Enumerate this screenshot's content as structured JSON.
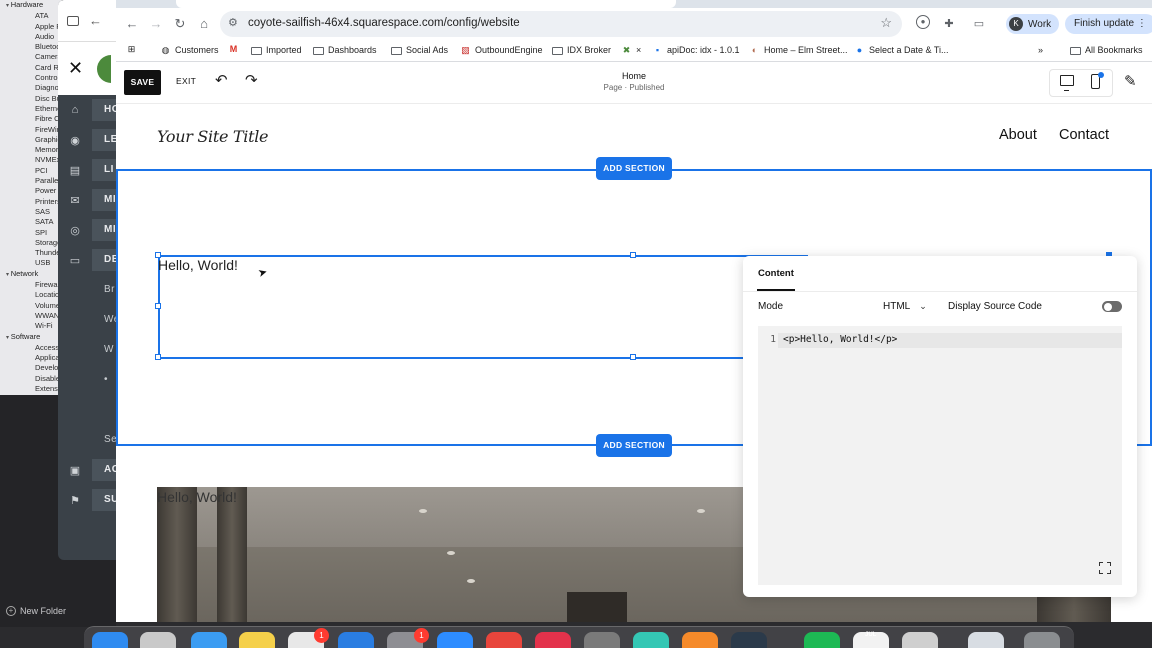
{
  "sysinfo": {
    "tree": [
      {
        "label": "Hardware",
        "level": "cat"
      },
      {
        "label": "ATA",
        "level": "sub"
      },
      {
        "label": "Apple Pay",
        "level": "sub"
      },
      {
        "label": "Audio",
        "level": "sub"
      },
      {
        "label": "Bluetooth",
        "level": "sub"
      },
      {
        "label": "Camera",
        "level": "sub"
      },
      {
        "label": "Card Reader",
        "level": "sub"
      },
      {
        "label": "Controller",
        "level": "sub"
      },
      {
        "label": "Diagnostics",
        "level": "sub"
      },
      {
        "label": "Disc Burning",
        "level": "sub"
      },
      {
        "label": "Ethernet",
        "level": "sub"
      },
      {
        "label": "Fibre Channel",
        "level": "sub"
      },
      {
        "label": "FireWire",
        "level": "sub"
      },
      {
        "label": "Graphics",
        "level": "sub"
      },
      {
        "label": "Memory",
        "level": "sub"
      },
      {
        "label": "NVMExpress",
        "level": "sub"
      },
      {
        "label": "PCI",
        "level": "sub"
      },
      {
        "label": "Parallel SCSI",
        "level": "sub"
      },
      {
        "label": "Power",
        "level": "sub"
      },
      {
        "label": "Printers",
        "level": "sub"
      },
      {
        "label": "SAS",
        "level": "sub"
      },
      {
        "label": "SATA",
        "level": "sub"
      },
      {
        "label": "SPI",
        "level": "sub"
      },
      {
        "label": "Storage",
        "level": "sub"
      },
      {
        "label": "Thunderbolt",
        "level": "sub"
      },
      {
        "label": "USB",
        "level": "sub"
      },
      {
        "label": "Network",
        "level": "cat"
      },
      {
        "label": "Firewall",
        "level": "sub"
      },
      {
        "label": "Locations",
        "level": "sub"
      },
      {
        "label": "Volumes",
        "level": "sub"
      },
      {
        "label": "WWAN",
        "level": "sub"
      },
      {
        "label": "Wi-Fi",
        "level": "sub"
      },
      {
        "label": "Software",
        "level": "cat"
      },
      {
        "label": "Accessibility",
        "level": "sub"
      },
      {
        "label": "Applications",
        "level": "sub"
      },
      {
        "label": "Developer",
        "level": "sub"
      },
      {
        "label": "Disabled Software",
        "level": "sub"
      },
      {
        "label": "Extensions",
        "level": "sub"
      }
    ],
    "new_folder": "New Folder"
  },
  "sq_sidebar": {
    "close_glyph": "✕",
    "nav": [
      {
        "label": "HO",
        "icon": "home-icon",
        "glyph": "⌂",
        "style": "bar"
      },
      {
        "label": "LE",
        "icon": "user-icon",
        "glyph": "◉",
        "style": "bar"
      },
      {
        "label": "LI",
        "icon": "document-icon",
        "glyph": "▤",
        "style": "bar"
      },
      {
        "label": "MI",
        "icon": "mail-icon",
        "glyph": "✉",
        "style": "bar"
      },
      {
        "label": "MI",
        "icon": "location-icon",
        "glyph": "◎",
        "style": "bar"
      },
      {
        "label": "DE",
        "icon": "monitor-icon",
        "glyph": "▭",
        "style": "bar"
      },
      {
        "label": "Br",
        "icon": "",
        "glyph": "",
        "style": "plain"
      },
      {
        "label": "We",
        "icon": "",
        "glyph": "",
        "style": "plain"
      },
      {
        "label": "W",
        "icon": "",
        "glyph": "",
        "style": "plain"
      },
      {
        "label": "•",
        "icon": "",
        "glyph": "",
        "style": "plain"
      },
      {
        "label": "",
        "icon": "",
        "glyph": "",
        "style": "plain"
      },
      {
        "label": "Se",
        "icon": "",
        "glyph": "",
        "style": "plain"
      },
      {
        "label": "AC",
        "icon": "box-icon",
        "glyph": "▣",
        "style": "bar"
      },
      {
        "label": "SU",
        "icon": "flag-icon",
        "glyph": "⚑",
        "style": "bar"
      }
    ]
  },
  "browser": {
    "url": "coyote-sailfish-46x4.squarespace.com/config/website",
    "profile_initial": "K",
    "profile_name": "Work",
    "finish_update": "Finish update",
    "bookmarks": [
      {
        "label": "",
        "icon": "apps-grid-icon",
        "glyph": "⊞"
      },
      {
        "label": "Customers",
        "icon": "globe-icon",
        "glyph": "◍"
      },
      {
        "label": "",
        "icon": "gmail-icon",
        "glyph": "M"
      },
      {
        "label": "Imported",
        "icon": "folder-icon",
        "glyph": ""
      },
      {
        "label": "Dashboards",
        "icon": "folder-icon",
        "glyph": ""
      },
      {
        "label": "Social Ads",
        "icon": "folder-icon",
        "glyph": ""
      },
      {
        "label": "OutboundEngine",
        "icon": "outboundengine-icon",
        "glyph": "▧"
      },
      {
        "label": "IDX Broker",
        "icon": "folder-icon",
        "glyph": ""
      },
      {
        "label": "×",
        "icon": "xano-icon",
        "glyph": "✖"
      },
      {
        "label": "apiDoc: idx - 1.0.1",
        "icon": "apidoc-icon",
        "glyph": "▪"
      },
      {
        "label": "Home – Elm Street...",
        "icon": "home-icon",
        "glyph": "◐"
      },
      {
        "label": "Select a Date & Ti...",
        "icon": "calendly-icon",
        "glyph": "●"
      }
    ],
    "all_bookmarks": "All Bookmarks"
  },
  "editor": {
    "save": "SAVE",
    "exit": "EXIT",
    "page_title": "Home",
    "page_status": "Page · Published",
    "site_title": "Your Site Title",
    "nav": [
      "About",
      "Contact"
    ],
    "add_section": "ADD SECTION",
    "block_text": "Hello, World!",
    "image_text": "Hello, World!"
  },
  "panel": {
    "tab": "Content",
    "mode_label": "Mode",
    "mode_value": "HTML",
    "source_label": "Display Source Code",
    "line_number": "1",
    "code": "<p>Hello, World!</p>"
  },
  "dock": {
    "badges": [
      "1",
      "1"
    ],
    "calendar_month": "JUL",
    "apps": [
      {
        "name": "finder-icon",
        "color": "#2f8bf0"
      },
      {
        "name": "launchpad-icon",
        "color": "#c9c9c9"
      },
      {
        "name": "safari-icon",
        "color": "#3b9cf2"
      },
      {
        "name": "notes-icon",
        "color": "#f5d04a"
      },
      {
        "name": "slack-icon",
        "color": "#e8e8e8"
      },
      {
        "name": "xcode-icon",
        "color": "#2a7de1"
      },
      {
        "name": "system-settings-icon",
        "color": "#8e8e93"
      },
      {
        "name": "zoom-icon",
        "color": "#2d8cff"
      },
      {
        "name": "chrome-icon",
        "color": "#e8453c"
      },
      {
        "name": "creative-cloud-icon",
        "color": "#e3324b"
      },
      {
        "name": "calculator-icon",
        "color": "#7a7a7a"
      },
      {
        "name": "messages-icon",
        "color": "#34c7b4"
      },
      {
        "name": "firefox-icon",
        "color": "#f58a2a"
      },
      {
        "name": "p-app-icon",
        "color": "#2b3a4a"
      },
      {
        "name": "spotify-icon",
        "color": "#1db954"
      },
      {
        "name": "calendar-icon",
        "color": "#f2f2f2"
      },
      {
        "name": "preview-icon",
        "color": "#cfcfcf"
      },
      {
        "name": "screenshot-window-icon",
        "color": "#d8dde3"
      },
      {
        "name": "trash-icon",
        "color": "#8a8d90"
      }
    ]
  }
}
